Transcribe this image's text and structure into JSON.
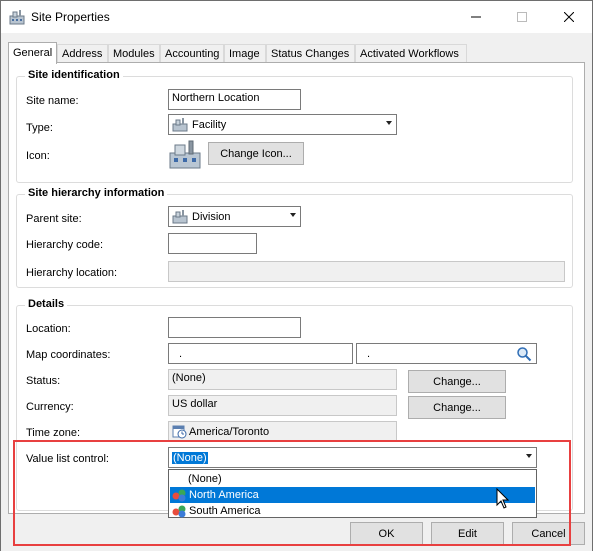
{
  "window": {
    "title": "Site Properties"
  },
  "tabs": [
    "General",
    "Address",
    "Modules",
    "Accounting",
    "Image",
    "Status Changes",
    "Activated Workflows"
  ],
  "site_identification": {
    "title": "Site identification",
    "site_name_label": "Site name:",
    "site_name_value": "Northern Location",
    "type_label": "Type:",
    "type_value": "Facility",
    "icon_label": "Icon:",
    "change_icon_button": "Change Icon..."
  },
  "site_hierarchy": {
    "title": "Site hierarchy information",
    "parent_site_label": "Parent site:",
    "parent_site_value": "Division",
    "hierarchy_code_label": "Hierarchy code:",
    "hierarchy_code_value": "",
    "hierarchy_location_label": "Hierarchy location:",
    "hierarchy_location_value": ""
  },
  "details": {
    "title": "Details",
    "location_label": "Location:",
    "location_value": "",
    "map_coordinates_label": "Map coordinates:",
    "map_lat_value": ".",
    "map_lon_value": ".",
    "status_label": "Status:",
    "status_value": "(None)",
    "status_change_button": "Change...",
    "currency_label": "Currency:",
    "currency_value": "US dollar",
    "currency_change_button": "Change...",
    "time_zone_label": "Time zone:",
    "time_zone_value": "America/Toronto",
    "value_list_label": "Value list control:",
    "value_list_value": "(None)",
    "value_list_options": [
      "(None)",
      "North America",
      "South America"
    ],
    "value_list_highlighted": "North America"
  },
  "buttons": {
    "ok": "OK",
    "edit": "Edit",
    "cancel": "Cancel"
  },
  "colors": {
    "selection": "#0078d7",
    "highlight_box": "#e84040"
  }
}
